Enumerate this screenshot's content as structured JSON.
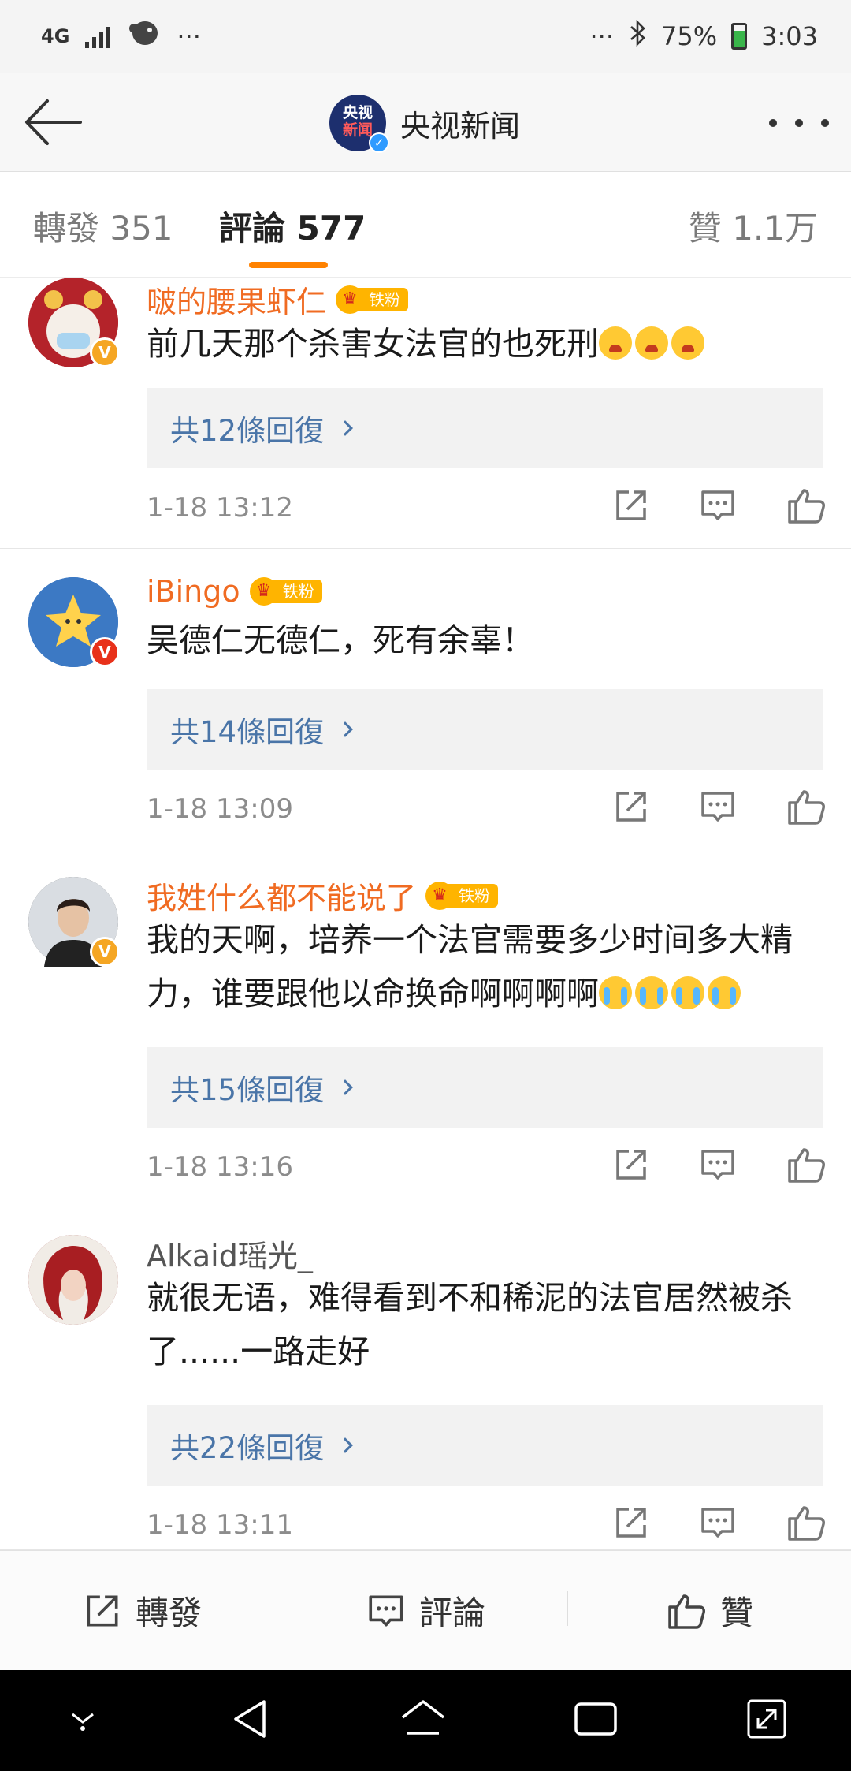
{
  "status_bar": {
    "network": "4G",
    "dots_left": "···",
    "dots_right": "···",
    "battery_percent": "75%",
    "time": "3:03"
  },
  "header": {
    "logo_text_1": "央视",
    "logo_text_2": "新闻",
    "title": "央视新闻"
  },
  "tabs": {
    "repost": "轉發 351",
    "comment": "評論 577",
    "like": "贊 1.1万"
  },
  "comments": [
    {
      "username": "啵的腰果虾仁",
      "fan_tag": "铁粉",
      "text": "前几天那个杀害女法官的也死刑",
      "emoji": [
        "angry",
        "angry",
        "angry"
      ],
      "replies": "共12條回復",
      "time": "1-18 13:12",
      "badge": "V",
      "badge_color": "#f5a623"
    },
    {
      "username": "iBingo",
      "fan_tag": "铁粉",
      "text": "吴德仁无德仁，死有余辜！",
      "emoji": [],
      "replies": "共14條回復",
      "time": "1-18 13:09",
      "badge": "V",
      "badge_color": "#e8311a"
    },
    {
      "username": "我姓什么都不能说了",
      "fan_tag": "铁粉",
      "text": "我的天啊，培养一个法官需要多少时间多大精力，谁要跟他以命换命啊啊啊啊",
      "emoji": [
        "cry",
        "cry",
        "cry",
        "cry"
      ],
      "replies": "共15條回復",
      "time": "1-18 13:16",
      "badge": "V",
      "badge_color": "#f5a623"
    },
    {
      "username": "Alkaid瑶光_",
      "fan_tag": "",
      "text": "就很无语，难得看到不和稀泥的法官居然被杀了......一路走好",
      "emoji": [],
      "replies": "共22條回復",
      "time": "1-18 13:11",
      "badge": "",
      "badge_color": ""
    }
  ],
  "toolbar": {
    "repost": "轉發",
    "comment": "評論",
    "like": "贊"
  },
  "colors": {
    "accent": "#ff8200",
    "username": "#f06b22",
    "reply_link": "#4a75a8"
  }
}
